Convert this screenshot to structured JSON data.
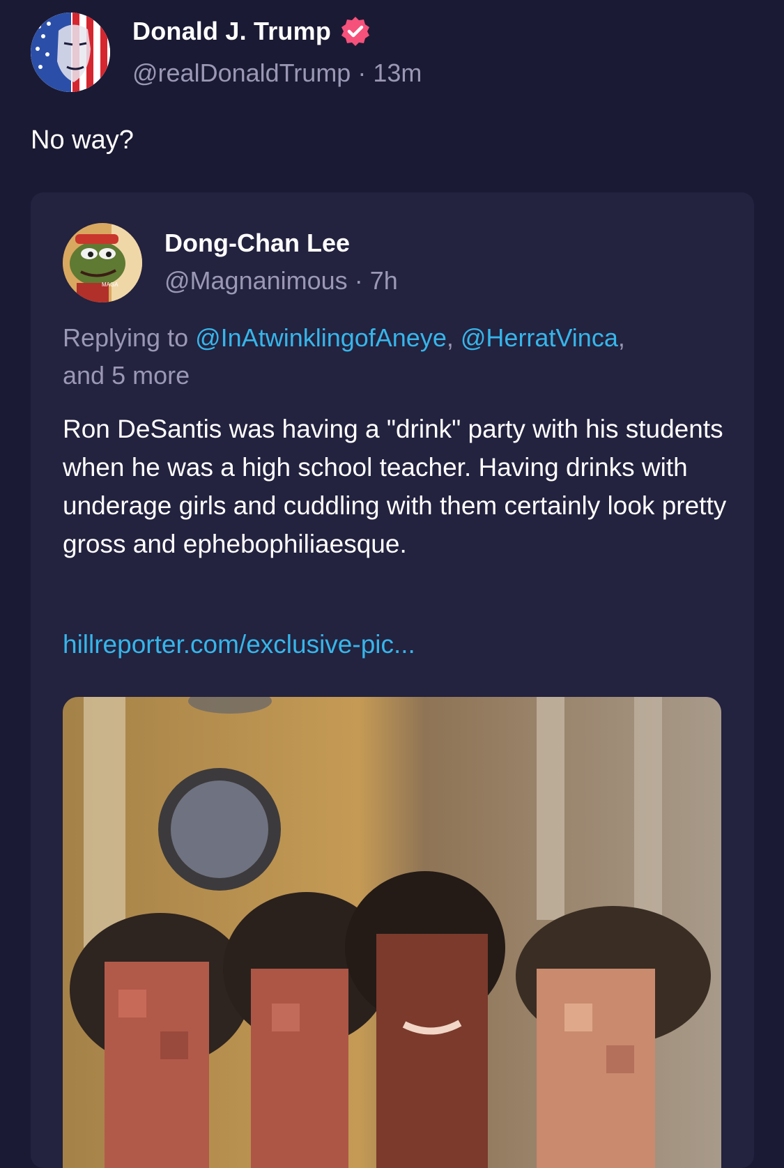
{
  "post": {
    "author_name": "Donald J. Trump",
    "handle": "@realDonaldTrump",
    "separator": "·",
    "time": "13m",
    "text": "No way?",
    "verified_icon": "verified-badge-icon",
    "verified_color": "#f5517b"
  },
  "quote": {
    "author_name": "Dong-Chan Lee",
    "handle": "@Magnanimous",
    "separator": "·",
    "time": "7h",
    "replying_prefix": "Replying to ",
    "mentions": [
      "@InAtwinklingofAneye",
      "@HerratVinca"
    ],
    "mention_sep": ", ",
    "more_text": "and 5 more",
    "text": "Ron DeSantis was having a \"drink\" party with his students when he was a high school teacher. Having drinks with underage girls and cuddling with them certainly look pretty gross and ephebophiliaesque.",
    "link": "hillreporter.com/exclusive-pic...",
    "avatar_badge_text": "MAGA"
  },
  "colors": {
    "background": "#1b1a34",
    "card": "#23223f",
    "muted": "#9a98b4",
    "link": "#36b6ea"
  }
}
